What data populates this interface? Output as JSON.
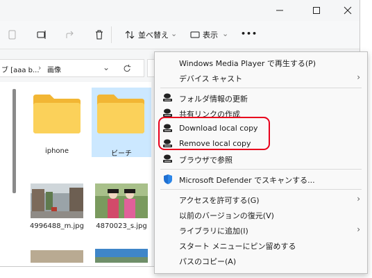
{
  "toolbar": {
    "sort_label": "並べ替え",
    "view_label": "表示",
    "more_label": "•••"
  },
  "address": {
    "path_part1": "ブ [aaa b...",
    "separator": "›",
    "path_part2": "画像"
  },
  "folders": [
    {
      "label": "iphone"
    },
    {
      "label": "ビーチ"
    }
  ],
  "images": [
    {
      "label": "4996488_m.jpg"
    },
    {
      "label": "4870023_s.jpg"
    }
  ],
  "context_menu": {
    "items": [
      {
        "label": "Windows Media Player で再生する(P)"
      },
      {
        "label": "デバイス キャスト",
        "submenu": true
      },
      {
        "label": "フォルダ情報の更新"
      },
      {
        "label": "共有リンクの作成"
      },
      {
        "label": "Download local copy"
      },
      {
        "label": "Remove local copy"
      },
      {
        "label": "ブラウザで参照"
      },
      {
        "label": "Microsoft Defender でスキャンする..."
      },
      {
        "label": "アクセスを許可する(G)",
        "submenu": true
      },
      {
        "label": "以前のバージョンの復元(V)"
      },
      {
        "label": "ライブラリに追加(I)",
        "submenu": true
      },
      {
        "label": "スタート メニューにピン留めする"
      },
      {
        "label": "パスのコピー(A)"
      }
    ]
  },
  "colors": {
    "accent": "#0067c0",
    "folder": "#f8c843",
    "highlight_border": "#e8001c"
  }
}
